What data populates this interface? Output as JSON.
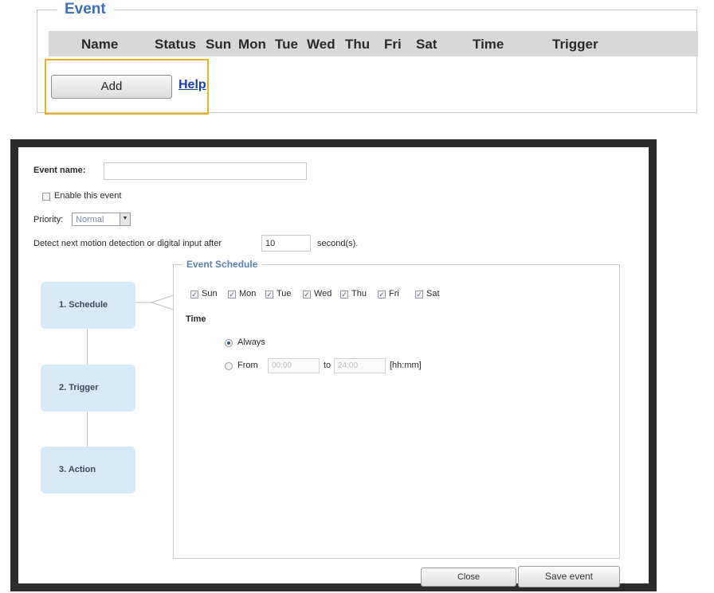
{
  "event_panel": {
    "legend": "Event",
    "columns": [
      "Name",
      "Status",
      "Sun",
      "Mon",
      "Tue",
      "Wed",
      "Thu",
      "Fri",
      "Sat",
      "Time",
      "Trigger"
    ],
    "add_label": "Add",
    "help_label": "Help",
    "highlight_color": "#e9b21f"
  },
  "dialog": {
    "event_name_label": "Event name:",
    "event_name_value": "",
    "enable_label": "Enable this event",
    "enable_checked": false,
    "priority_label": "Priority:",
    "priority_value": "Normal",
    "detect_label": "Detect next motion detection or digital input after",
    "detect_value": "10",
    "detect_unit": "second(s).",
    "steps": [
      "1. Schedule",
      "2. Trigger",
      "3. Action"
    ],
    "schedule": {
      "legend": "Event Schedule",
      "days": [
        {
          "label": "Sun",
          "checked": true
        },
        {
          "label": "Mon",
          "checked": true
        },
        {
          "label": "Tue",
          "checked": true
        },
        {
          "label": "Wed",
          "checked": true
        },
        {
          "label": "Thu",
          "checked": true
        },
        {
          "label": "Fri",
          "checked": true
        },
        {
          "label": "Sat",
          "checked": true
        }
      ],
      "time_label": "Time",
      "always_label": "Always",
      "always_selected": true,
      "from_label": "From",
      "from_value": "00:00",
      "to_label": "to",
      "to_value": "24:00",
      "format_hint": "[hh:mm]"
    },
    "close_label": "Close",
    "save_label": "Save event"
  }
}
